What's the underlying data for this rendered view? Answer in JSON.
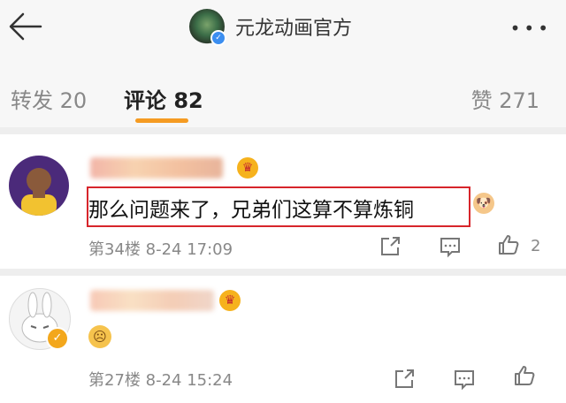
{
  "header": {
    "title": "元龙动画官方",
    "back_icon": "back-arrow-icon",
    "more_icon": "more-icon",
    "verified_icon": "verified-icon"
  },
  "tabs": {
    "repost": "转发 20",
    "comment": "评论 82",
    "like": "赞 271"
  },
  "colors": {
    "accent": "#f59b22",
    "highlight_box": "#d7252b"
  },
  "comments": [
    {
      "text": "那么问题来了，兄弟们这算不算炼铜",
      "floor_time": "第34楼  8-24 17:09",
      "like_count": "2"
    },
    {
      "text": "",
      "floor_time": "第27楼  8-24 15:24",
      "like_count": ""
    }
  ]
}
